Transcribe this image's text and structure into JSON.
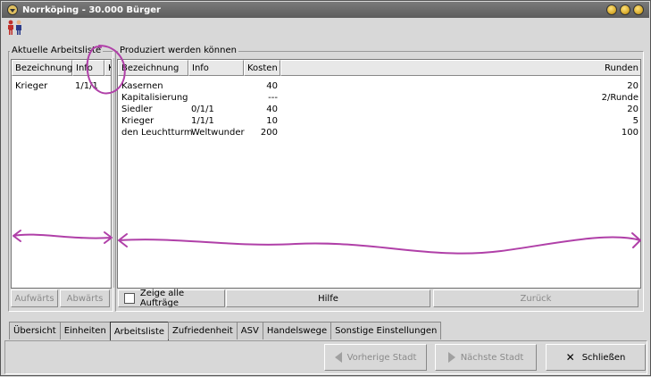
{
  "window": {
    "title": "Norrköping - 30.000 Bürger"
  },
  "icons": {
    "window_menu": "window-menu-icon",
    "minimize": "minimize-icon",
    "maximize": "maximize-icon",
    "close": "close-icon",
    "citizens": "citizens-icon"
  },
  "left_panel": {
    "label": "Aktuelle Arbeitsliste",
    "columns": [
      "Bezeichnung",
      "Info",
      "K"
    ],
    "rows": [
      {
        "name": "Krieger",
        "info": "1/1/1"
      }
    ],
    "up_button": "Aufwärts",
    "down_button": "Abwärts"
  },
  "right_panel": {
    "label": "Produziert werden können",
    "columns": [
      "Bezeichnung",
      "Info",
      "Kosten",
      "Runden"
    ],
    "rows": [
      {
        "name": "Kasernen",
        "info": "",
        "cost": "40",
        "turns": "20"
      },
      {
        "name": "Kapitalisierung",
        "info": "",
        "cost": "---",
        "turns": "2/Runde"
      },
      {
        "name": "Siedler",
        "info": "0/1/1",
        "cost": "40",
        "turns": "20"
      },
      {
        "name": "Krieger",
        "info": "1/1/1",
        "cost": "10",
        "turns": "5"
      },
      {
        "name": "den Leuchtturm",
        "info": "Weltwunder",
        "cost": "200",
        "turns": "100"
      }
    ],
    "show_all_label": "Zeige alle Aufträge",
    "help_button": "Hilfe",
    "back_button": "Zurück"
  },
  "tabs": [
    {
      "label": "Übersicht",
      "active": false
    },
    {
      "label": "Einheiten",
      "active": false
    },
    {
      "label": "Arbeitsliste",
      "active": true
    },
    {
      "label": "Zufriedenheit",
      "active": false
    },
    {
      "label": "ASV",
      "active": false
    },
    {
      "label": "Handelswege",
      "active": false
    },
    {
      "label": "Sonstige Einstellungen",
      "active": false
    }
  ],
  "bottom": {
    "prev_city": "Vorherige Stadt",
    "next_city": "Nächste Stadt",
    "close": "Schließen"
  },
  "colors": {
    "annotation": "#b040a8",
    "disabled_text": "#8a8a8a"
  }
}
